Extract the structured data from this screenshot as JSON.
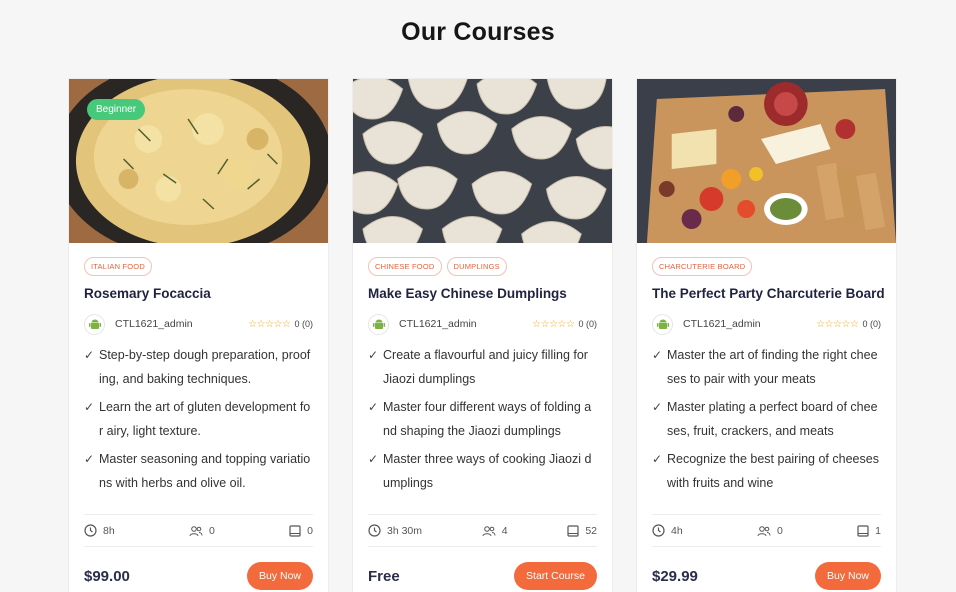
{
  "page": {
    "title": "Our Courses"
  },
  "colors": {
    "accent": "#f36a3d",
    "badge": "#47c97b",
    "star": "#f5a623"
  },
  "courses": [
    {
      "level": "Beginner",
      "tags": [
        "ITALIAN FOOD"
      ],
      "title": "Rosemary Focaccia",
      "author": "CTL1621_admin",
      "stars": "☆☆☆☆☆",
      "rating": "0 (0)",
      "points": [
        "Step-by-step dough preparation, proofing, and baking techniques.",
        "Learn the art of gluten development for airy, light texture.",
        "Master seasoning and topping variations with herbs and olive oil."
      ],
      "duration": "8h",
      "students": "0",
      "lessons": "0",
      "price": "$99.00",
      "button": "Buy Now"
    },
    {
      "level": "",
      "tags": [
        "CHINESE FOOD",
        "DUMPLINGS"
      ],
      "title": "Make Easy Chinese Dumplings",
      "author": "CTL1621_admin",
      "stars": "☆☆☆☆☆",
      "rating": "0 (0)",
      "points": [
        "Create a flavourful and juicy filling for Jiaozi dumplings",
        "Master four different ways of folding and shaping the Jiaozi dumplings",
        "Master three ways of cooking Jiaozi dumplings"
      ],
      "duration": "3h 30m",
      "students": "4",
      "lessons": "52",
      "price": "Free",
      "button": "Start Course"
    },
    {
      "level": "",
      "tags": [
        "CHARCUTERIE BOARD"
      ],
      "title": "The Perfect Party Charcuterie Board",
      "author": "CTL1621_admin",
      "stars": "☆☆☆☆☆",
      "rating": "0 (0)",
      "points": [
        "Master the art of finding the right cheeses to pair with your meats",
        "Master plating a perfect board of cheeses, fruit, crackers, and meats",
        "Recognize the best pairing of cheeses with fruits and wine"
      ],
      "duration": "4h",
      "students": "0",
      "lessons": "1",
      "price": "$29.99",
      "button": "Buy Now"
    }
  ]
}
